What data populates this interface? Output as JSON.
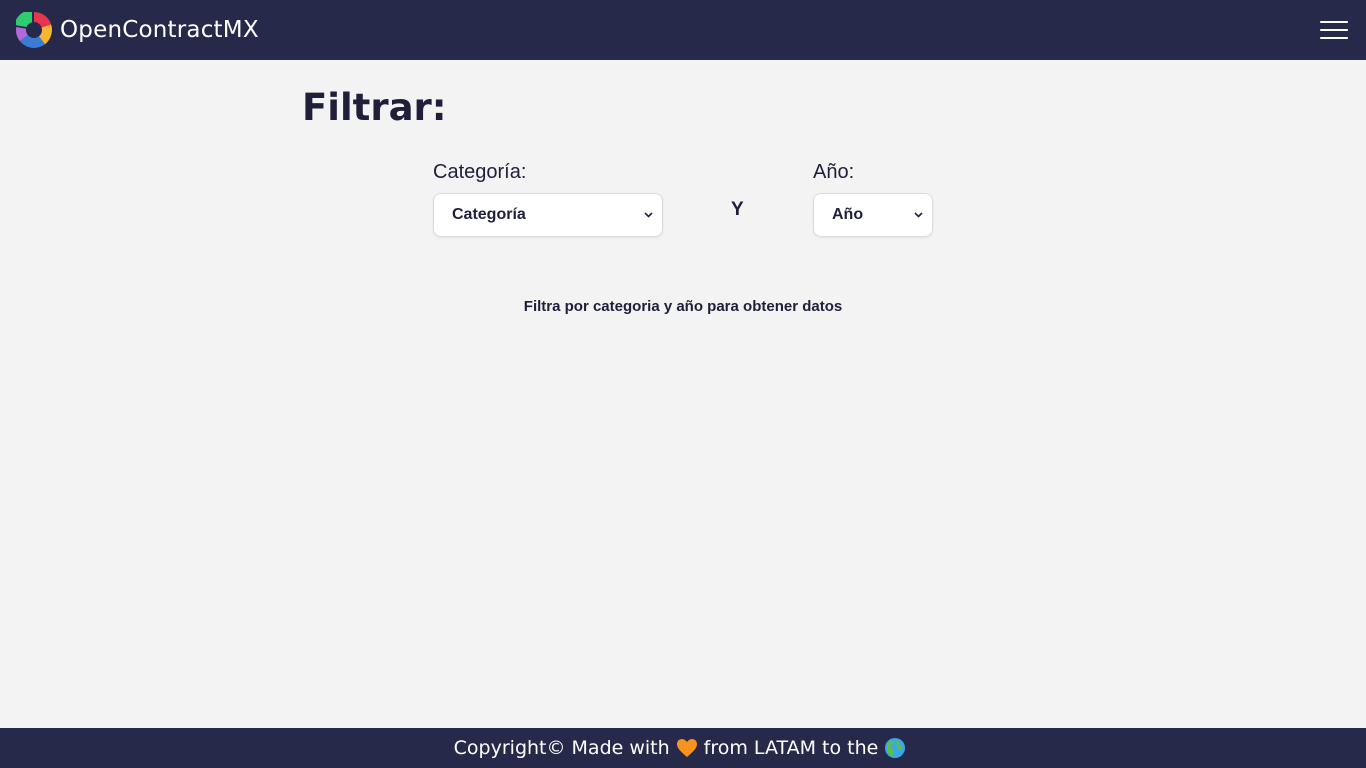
{
  "navbar": {
    "brand": "OpenContractMX",
    "logo_icon": "pie-logo-icon",
    "menu_icon": "hamburger-menu-icon",
    "background": "#27294a"
  },
  "main": {
    "title": "Filtrar:",
    "category": {
      "label": "Categoría:",
      "selected": "Categoría"
    },
    "separator": "Y",
    "year": {
      "label": "Año:",
      "selected": "Año"
    },
    "hint": "Filtra por categoria y año para obtener datos"
  },
  "footer": {
    "before_heart": "Copyright© Made with",
    "after_heart": "from LATAM to the",
    "heart_icon": "orange-heart-icon",
    "globe_icon": "globe-americas-icon",
    "heart_color": "#f7941d"
  }
}
